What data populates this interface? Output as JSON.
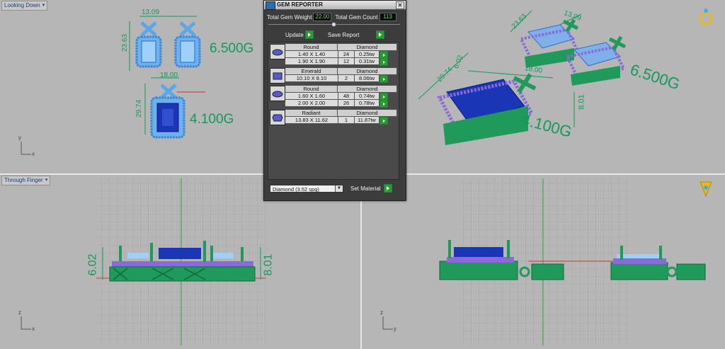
{
  "viewports": {
    "top_left": {
      "label": "Looking Down"
    },
    "bottom_left": {
      "label": "Through Finger"
    }
  },
  "annotations": {
    "earring_width": "13.09",
    "earring_height": "23.63",
    "earring_weight": "6.500G",
    "pendant_width": "18.00",
    "pendant_height": "29.74",
    "pendant_weight": "4.100G",
    "persp_earring_height": "23.63",
    "persp_earring_width": "13.09",
    "persp_pendant_height": "29.74",
    "persp_pendant_depth": "6.02",
    "persp_pendant_width": "18.00",
    "persp_side_height": "8.01",
    "side_height_left": "6.02",
    "side_height_right": "8.01"
  },
  "axes": {
    "x": "x",
    "y": "y",
    "z": "z"
  },
  "gem_reporter": {
    "title": "GEM REPORTER",
    "total_weight_label": "Total Gem Weight",
    "total_weight_value": "22.00",
    "total_count_label": "Total Gem Count",
    "total_count_value": "113",
    "update_label": "Update",
    "save_report_label": "Save Report",
    "gems": [
      {
        "shape": "Round",
        "material": "Diamond",
        "rows": [
          {
            "dim": "1.40 X 1.40",
            "count": "24",
            "tw": "0.25tw"
          },
          {
            "dim": "1.90 X 1.90",
            "count": "12",
            "tw": "0.31tw"
          }
        ]
      },
      {
        "shape": "Emerald",
        "material": "Diamond",
        "rows": [
          {
            "dim": "10.10 X 8.10",
            "count": "2",
            "tw": "8.06tw"
          }
        ]
      },
      {
        "shape": "Round",
        "material": "Diamond",
        "rows": [
          {
            "dim": "1.60 X 1.60",
            "count": "48",
            "tw": "0.74tw"
          },
          {
            "dim": "2.00 X 2.00",
            "count": "26",
            "tw": "0.78tw"
          }
        ]
      },
      {
        "shape": "Radiant",
        "material": "Diamond",
        "rows": [
          {
            "dim": "13.83 X 11.62",
            "count": "1",
            "tw": "11.87tw"
          }
        ]
      }
    ],
    "material_select": "Diamond      (3.52 spg)",
    "set_material_label": "Set Material"
  },
  "colors": {
    "metal": "#1f9a5a",
    "stone_blue": "#1a35b5",
    "stone_light": "#7ab8f0",
    "dim_green": "#129a5a"
  }
}
